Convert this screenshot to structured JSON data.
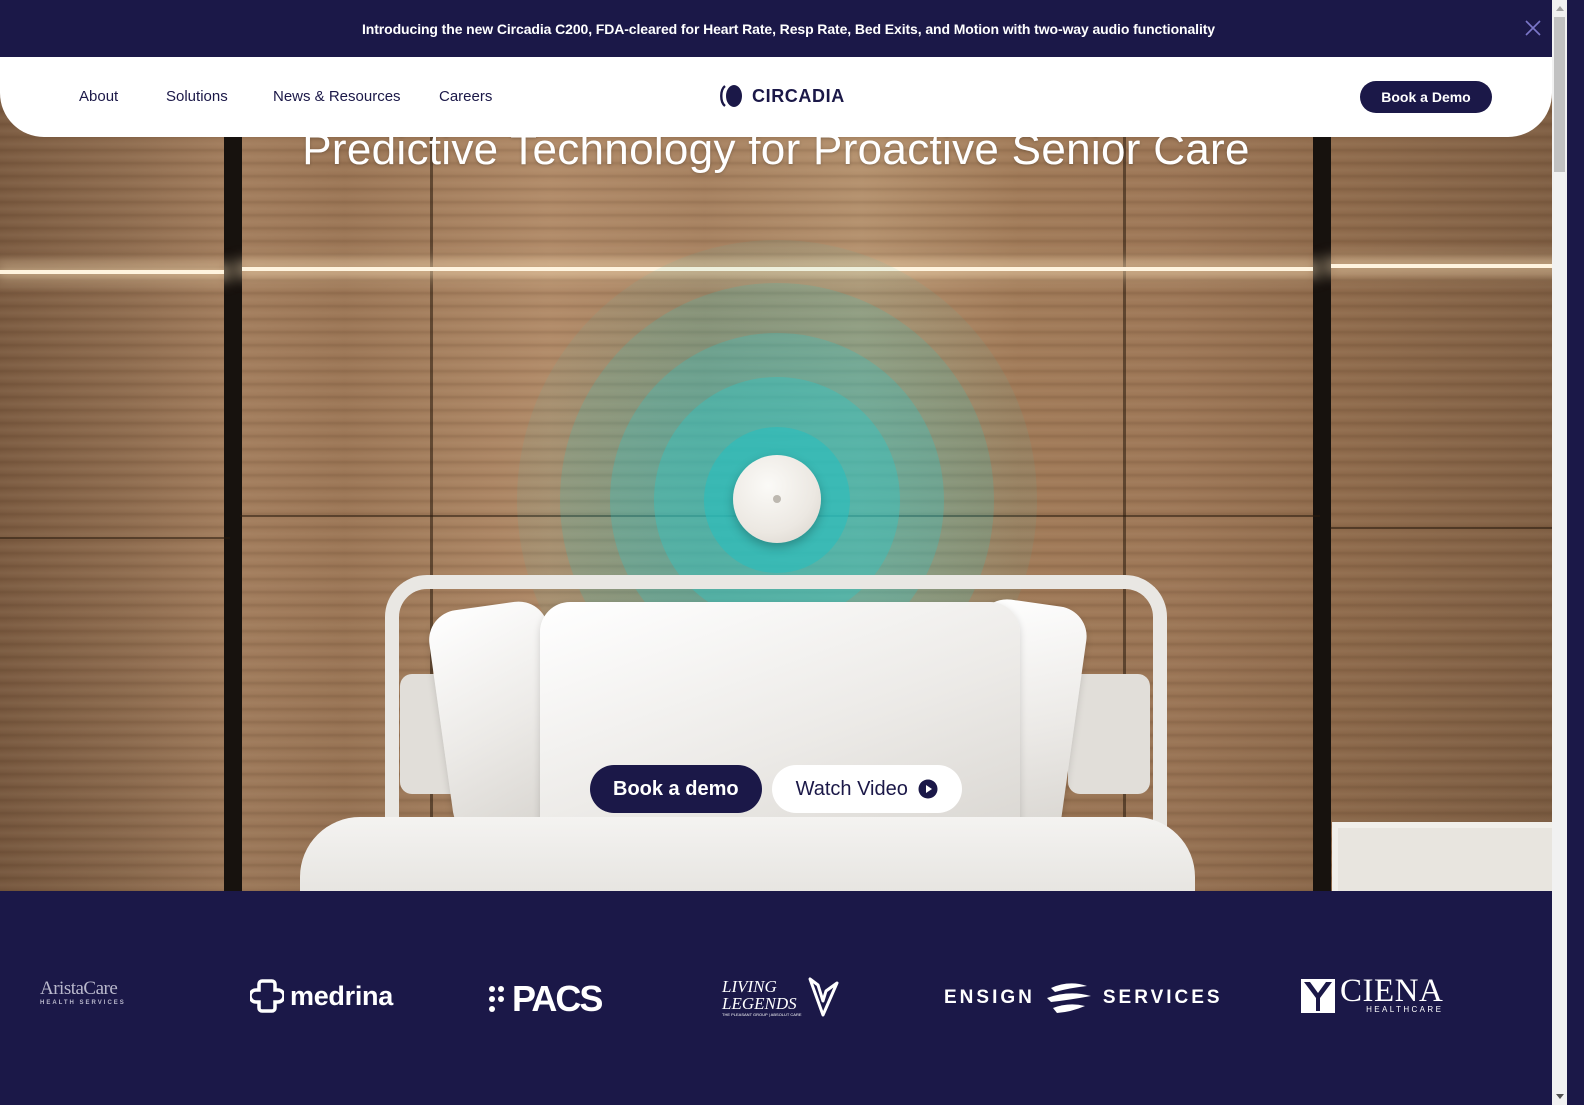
{
  "announcement": {
    "text": "Introducing the new Circadia C200, FDA-cleared for Heart Rate, Resp Rate, Bed Exits, and Motion with two-way audio functionality",
    "close_icon": "close-icon"
  },
  "nav": {
    "links": [
      {
        "label": "About"
      },
      {
        "label": "Solutions"
      },
      {
        "label": "News & Resources"
      },
      {
        "label": "Careers"
      }
    ],
    "logo_text": "CIRCADIA",
    "cta_label": "Book a Demo"
  },
  "hero": {
    "title": "Predictive Technology for Proactive Senior Care",
    "primary_button": "Book a demo",
    "secondary_button": "Watch Video",
    "secondary_icon": "play-circle-icon"
  },
  "partners": {
    "logos": [
      {
        "name": "AristaCare",
        "subtitle": "HEALTH SERVICES"
      },
      {
        "name": "medrina"
      },
      {
        "name": "PACS"
      },
      {
        "name": "LIVING LEGENDS",
        "subtitle": "THE PLEASANT GROUP | ABSOLUT CARE"
      },
      {
        "name_left": "ENSIGN",
        "name_right": "SERVICES"
      },
      {
        "name": "CIENA",
        "subtitle": "HEALTHCARE"
      }
    ]
  },
  "colors": {
    "brand_navy": "#1b1848",
    "accent_teal": "#2fc6c4",
    "white": "#ffffff"
  }
}
